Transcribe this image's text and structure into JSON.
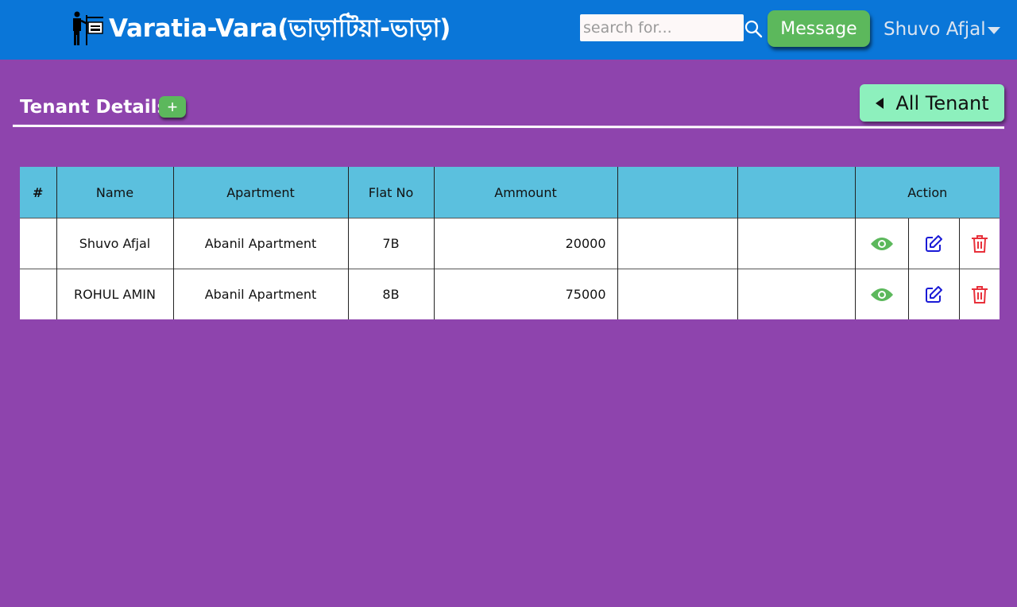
{
  "header": {
    "brand": "Varatia-Vara(ভাড়াটিয়া-ভাড়া)",
    "search_placeholder": "search for...",
    "message_label": "Message",
    "user_name": "Shuvo Afjal"
  },
  "section": {
    "title": "Tenant Details",
    "add_label": "+",
    "all_tenant_label": "All Tenant"
  },
  "table": {
    "headers": [
      "#",
      "Name",
      "Apartment",
      "Flat No",
      "Ammount",
      "",
      "",
      "Action"
    ],
    "rows": [
      {
        "index": "",
        "name": "Shuvo Afjal",
        "apartment": "Abanil Apartment",
        "flat": "7B",
        "amount": "20000"
      },
      {
        "index": "",
        "name": "ROHUL AMIN",
        "apartment": "Abanil Apartment",
        "flat": "8B",
        "amount": "75000"
      }
    ]
  },
  "colors": {
    "page_bg": "#8e44ad",
    "topbar": "#0a76d8",
    "header_cell": "#5bc0de",
    "view_icon": "#5cb85c",
    "edit_icon": "#1a1ad6",
    "delete_icon": "#e8303a",
    "all_tenant_btn": "#8df0bd"
  },
  "icons": {
    "logo": "tenant-rent-sign-icon",
    "search": "search-icon",
    "caret": "caret-down-icon",
    "back": "caret-left-icon",
    "view": "eye-icon",
    "edit": "edit-icon",
    "delete": "trash-icon"
  }
}
